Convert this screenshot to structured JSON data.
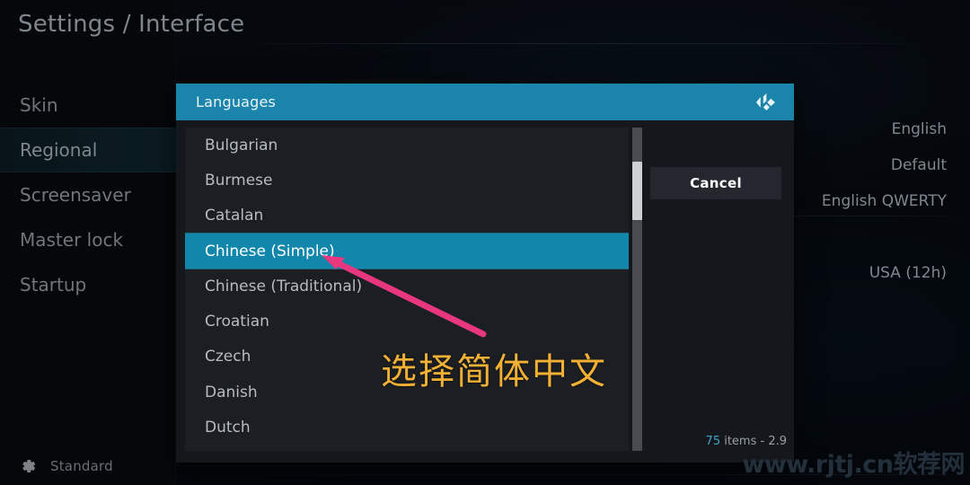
{
  "header": {
    "title": "Settings / Interface"
  },
  "sidebar": {
    "items": [
      {
        "label": "Skin",
        "selected": false
      },
      {
        "label": "Regional",
        "selected": true
      },
      {
        "label": "Screensaver",
        "selected": false
      },
      {
        "label": "Master lock",
        "selected": false
      },
      {
        "label": "Startup",
        "selected": false
      }
    ],
    "footer": {
      "icon": "gear-icon",
      "label": "Standard"
    }
  },
  "settings_values": [
    {
      "label": "English"
    },
    {
      "label": "Default"
    },
    {
      "label": "English QWERTY"
    },
    {
      "label": ""
    },
    {
      "label": "USA (12h)"
    }
  ],
  "dialog": {
    "title": "Languages",
    "logo": "kodi-logo",
    "cancel_label": "Cancel",
    "items_count": {
      "count": "75",
      "text": " items - 2.9"
    },
    "languages": [
      {
        "label": "Bulgarian",
        "selected": false
      },
      {
        "label": "Burmese",
        "selected": false
      },
      {
        "label": "Catalan",
        "selected": false
      },
      {
        "label": "Chinese (Simple)",
        "selected": true
      },
      {
        "label": "Chinese (Traditional)",
        "selected": false
      },
      {
        "label": "Croatian",
        "selected": false
      },
      {
        "label": "Czech",
        "selected": false
      },
      {
        "label": "Danish",
        "selected": false
      },
      {
        "label": "Dutch",
        "selected": false
      }
    ]
  },
  "annotations": {
    "note_text": "选择简体中文",
    "arrow_color": "#e8377f",
    "note_color": "#f2b134"
  },
  "watermark": {
    "text": "www.rjtj.cn软荐网"
  },
  "colors": {
    "accent": "#1187ab",
    "header_bar": "#1b84ab",
    "dialog_bg": "#14171c",
    "list_bg": "#1b1e23"
  }
}
